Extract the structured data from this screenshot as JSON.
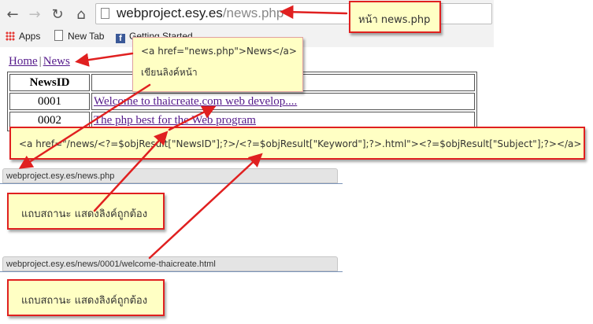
{
  "browser": {
    "back_icon": "back-arrow-icon",
    "forward_icon": "forward-arrow-icon",
    "reload_icon": "reload-icon",
    "home_icon": "home-icon",
    "url_host": "webproject.esy.es",
    "url_path": "/news.php",
    "bookmarks": [
      {
        "label": "Apps",
        "icon": "apps-grid-icon"
      },
      {
        "label": "New Tab",
        "icon": "page-icon"
      },
      {
        "label": "Getting Started",
        "icon": "facebook-icon"
      }
    ]
  },
  "page": {
    "nav": {
      "home": "Home",
      "separator": "|",
      "news": "News"
    },
    "table": {
      "header": {
        "id": "NewsID",
        "subject": ""
      },
      "rows": [
        {
          "id": "0001",
          "subject": "Welcome to thaicreate.com web develop...."
        },
        {
          "id": "0002",
          "subject": "The php best for the Web program"
        }
      ]
    }
  },
  "annotations": {
    "title_note": "หน้า news.php",
    "link_code": "<a href=\"news.php\">News</a>",
    "link_note": "เขียนลิงค์หน้า",
    "rewrite_code": "<a href=\"/news/<?=$objResult[\"NewsID\"];?>/<?=$objResult[\"Keyword\"];?>.html\"><?=$objResult[\"Subject\"];?></a>",
    "status_note_1": "แถบสถานะ แสดงลิงค์ถูกต้อง",
    "status_note_2": "แถบสถานะ แสดงลิงค์ถูกต้อง"
  },
  "statusbars": {
    "first": "webproject.esy.es/news.php",
    "second": "webproject.esy.es/news/0001/welcome-thaicreate.html"
  },
  "colors": {
    "callout_bg": "#ffffc4",
    "callout_border": "#e02020",
    "arrow": "#e02020",
    "visited_link": "#551a8b"
  }
}
